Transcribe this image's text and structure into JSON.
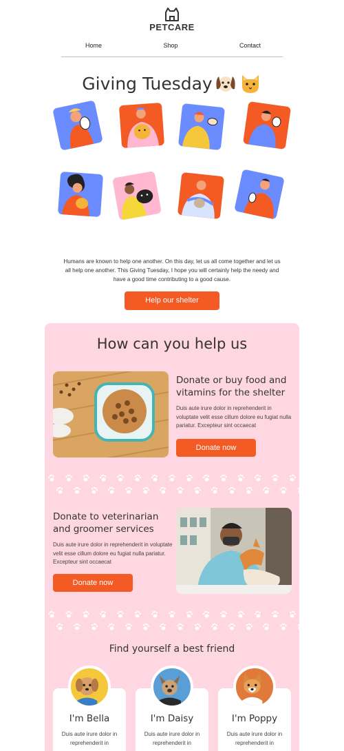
{
  "header": {
    "brand": "PETCARE",
    "nav": [
      "Home",
      "Shop",
      "Contact"
    ]
  },
  "hero": {
    "title": "Giving Tuesday",
    "emoji_icons": [
      "dog-face-icon",
      "cat-face-icon"
    ],
    "body": "Humans are known to help one another. On this day, let us all come together and let us all help one another. This Giving Tuesday, I hope you will certainly help the needy and have a good time contributing to a good cause.",
    "button": "Help our shelter"
  },
  "help": {
    "title": "How can you help us",
    "items": [
      {
        "heading": "Donate or buy food and vitamins for the shelter",
        "text": "Duis aute irure dolor in reprehenderit in voluptate velit esse cillum dolore eu fugiat nulla pariatur. Excepteur sint occaecat",
        "button": "Donate now"
      },
      {
        "heading": "Donate to veterinarian and groomer services",
        "text": "Duis aute irure dolor in reprehenderit in voluptate velit esse cillum dolore eu fugiat nulla pariatur. Excepteur sint occaecat",
        "button": "Donate now"
      }
    ]
  },
  "friends": {
    "title": "Find yourself a best friend",
    "cards": [
      {
        "name": "I'm Bella",
        "text": "Duis aute irure dolor in reprehenderit in"
      },
      {
        "name": "I'm Daisy",
        "text": "Duis aute irure dolor in reprehenderit in"
      },
      {
        "name": "I'm Poppy",
        "text": "Duis aute irure dolor in reprehenderit in"
      }
    ]
  },
  "colors": {
    "accent": "#f45a24",
    "panel": "#ffd7e2",
    "tile_blue": "#6b8cff",
    "tile_orange": "#f45a24",
    "tile_pink": "#ffb8cf"
  }
}
